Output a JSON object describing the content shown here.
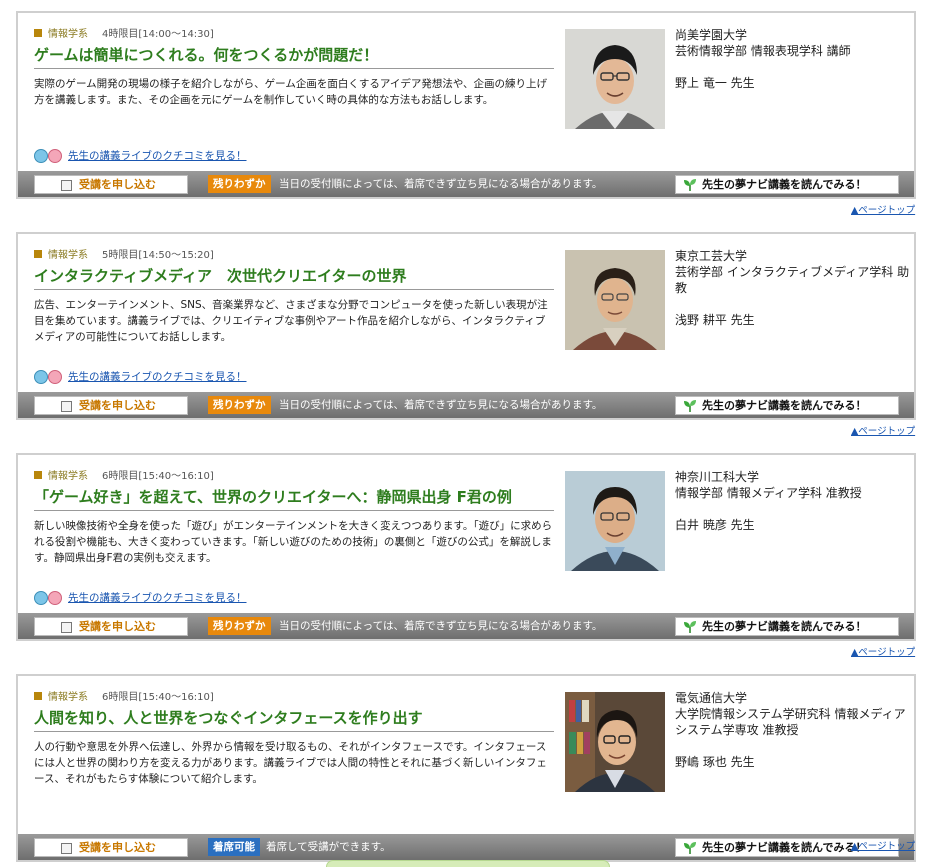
{
  "courses": [
    {
      "category": "情報学系",
      "period": "4時限目[14:00～14:30]",
      "title": "ゲームは簡単につくれる。何をつくるかが問題だ！",
      "description": "実際のゲーム開発の現場の様子を紹介しながら、ゲーム企画を面白くするアイデア発想法や、企画の練り上げ方を講義します。また、その企画を元にゲームを制作していく時の具体的な方法もお話しします。",
      "review_link": "先生の講義ライブのクチコミを見る！",
      "university": "尚美学園大学",
      "department": "芸術情報学部 情報表現学科 講師",
      "teacher": "野上 竜一 先生",
      "apply_label": "受講を申し込む",
      "status_label": "残りわずか",
      "status_note": "当日の受付順によっては、着席できず立ち見になる場合があります。",
      "yume_label": "先生の夢ナビ講義を読んでみる！",
      "pagetop": "▲ページトップ"
    },
    {
      "category": "情報学系",
      "period": "5時限目[14:50～15:20]",
      "title": "インタラクティブメディア　次世代クリエイターの世界",
      "description": "広告、エンターテインメント、SNS、音楽業界など、さまざまな分野でコンピュータを使った新しい表現が注目を集めています。講義ライブでは、クリエイティブな事例やアート作品を紹介しながら、インタラクティブメディアの可能性についてお話しします。",
      "review_link": "先生の講義ライブのクチコミを見る！",
      "university": "東京工芸大学",
      "department": "芸術学部 インタラクティブメディア学科 助教",
      "teacher": "浅野 耕平 先生",
      "apply_label": "受講を申し込む",
      "status_label": "残りわずか",
      "status_note": "当日の受付順によっては、着席できず立ち見になる場合があります。",
      "yume_label": "先生の夢ナビ講義を読んでみる！",
      "pagetop": "▲ページトップ"
    },
    {
      "category": "情報学系",
      "period": "6時限目[15:40～16:10]",
      "title": "「ゲーム好き」を超えて、世界のクリエイターへ：静岡県出身 F君の例",
      "description": "新しい映像技術や全身を使った「遊び」がエンターテインメントを大きく変えつつあります。「遊び」に求められる役割や機能も、大きく変わっていきます。「新しい遊びのための技術」の裏側と「遊びの公式」を解説します。静岡県出身F君の実例も交えます。",
      "review_link": "先生の講義ライブのクチコミを見る！",
      "university": "神奈川工科大学",
      "department": "情報学部 情報メディア学科 准教授",
      "teacher": "白井 暁彦 先生",
      "apply_label": "受講を申し込む",
      "status_label": "残りわずか",
      "status_note": "当日の受付順によっては、着席できず立ち見になる場合があります。",
      "yume_label": "先生の夢ナビ講義を読んでみる！",
      "pagetop": "▲ページトップ"
    },
    {
      "category": "情報学系",
      "period": "6時限目[15:40～16:10]",
      "title": "人間を知り、人と世界をつなぐインタフェースを作り出す",
      "description": "人の行動や意思を外界へ伝達し、外界から情報を受け取るもの、それがインタフェースです。インタフェースには人と世界の関わり方を変える力があります。講義ライブでは人間の特性とそれに基づく新しいインタフェース、それがもたらす体験について紹介します。",
      "review_link": "",
      "university": "電気通信大学",
      "department": "大学院情報システム学研究科 情報メディアシステム学専攻 准教授",
      "teacher": "野嶋 琢也 先生",
      "apply_label": "受講を申し込む",
      "status_label": "着席可能",
      "status_note": "着席して受講ができます。",
      "yume_label": "先生の夢ナビ講義を読んでみる！",
      "pagetop": "▲ページトップ"
    }
  ],
  "colors": {
    "title_green": "#2e7d1e",
    "status_few": "#e8890c",
    "status_ok": "#2a6fc0",
    "link_blue": "#1a56b0"
  }
}
